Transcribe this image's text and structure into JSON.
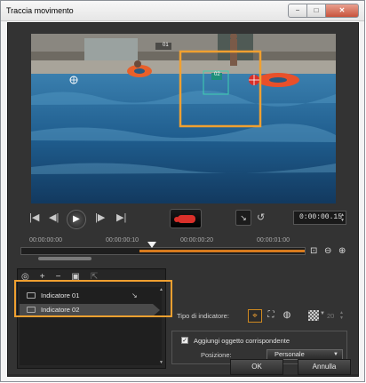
{
  "window": {
    "title": "Traccia movimento",
    "controls": {
      "minimize": "−",
      "maximize": "□",
      "close": "✕"
    }
  },
  "video": {
    "tracker1_label": "01",
    "tracker2_label": "02"
  },
  "transport": {
    "start_icon": "|◀",
    "prev_frame_icon": "◀|",
    "play_icon": "▶",
    "next_frame_icon": "|▶",
    "end_icon": "▶|",
    "link_icon": "↘",
    "reset_icon": "↺",
    "timecode": "0:00:00.15"
  },
  "timeline": {
    "ticks": [
      "00:00:00:00",
      "00:00:00:10",
      "00:00:00:20",
      "00:00:01:00"
    ],
    "progress": 0.42,
    "zoom_fit_icon": "⊡",
    "zoom_out_icon": "⊖",
    "zoom_in_icon": "⊕"
  },
  "tracker_panel": {
    "tools": [
      "◎",
      "+",
      "−",
      "▣",
      "⇱"
    ],
    "items": [
      {
        "label": "Indicatore 01",
        "selected": false
      },
      {
        "label": "Indicatore 02",
        "selected": true
      }
    ]
  },
  "settings": {
    "type_label": "Tipo di indicatore:",
    "type_icons": [
      "⌖",
      "⛶",
      "◍"
    ],
    "size_value": "20",
    "checkbox_label": "Aggiungi oggetto corrispondente",
    "checkbox_checked": true,
    "position_label": "Posizione:",
    "position_value": "Personale"
  },
  "buttons": {
    "ok": "OK",
    "cancel": "Annulla"
  },
  "colors": {
    "accent": "#f0a030",
    "record": "#d9302a",
    "panel": "#333333"
  }
}
